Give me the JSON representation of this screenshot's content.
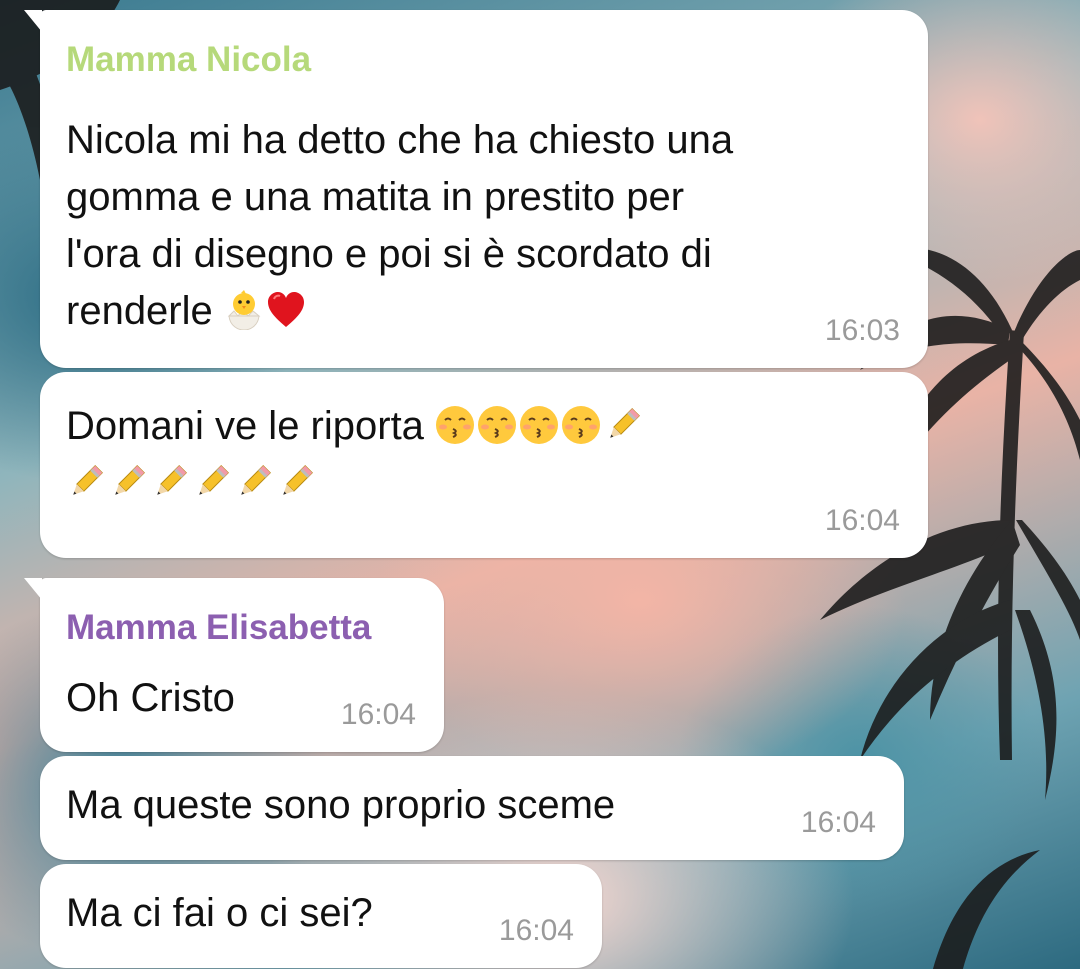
{
  "chat": {
    "messages": [
      {
        "sender": "Mamma Nicola",
        "sender_color": "#b6d97a",
        "lines": [
          "Nicola mi ha detto che ha chiesto una",
          "gomma e una matita in prestito per",
          "l'ora di disegno e poi si è scordato di",
          "renderle"
        ],
        "emojis": [
          "hatching-chick-emoji",
          "red-heart-emoji"
        ],
        "time": "16:03"
      },
      {
        "sender": "",
        "lines": [
          "Domani ve le riporta"
        ],
        "emojis": [
          "kissing-face-emoji",
          "kissing-face-emoji",
          "kissing-face-emoji",
          "kissing-face-emoji",
          "pencil-emoji",
          "pencil-emoji",
          "pencil-emoji",
          "pencil-emoji",
          "pencil-emoji",
          "pencil-emoji",
          "pencil-emoji"
        ],
        "time": "16:04"
      },
      {
        "sender": "Mamma Elisabetta",
        "sender_color": "#8c5fb0",
        "lines": [
          "Oh Cristo"
        ],
        "time": "16:04"
      },
      {
        "sender": "",
        "lines": [
          "Ma queste sono proprio sceme"
        ],
        "time": "16:04"
      },
      {
        "sender": "",
        "lines": [
          "Ma ci fai o ci sei?"
        ],
        "time": "16:04"
      }
    ]
  },
  "colors": {
    "bubble": "#ffffff",
    "text": "#111111",
    "time": "#9a9a9a"
  }
}
